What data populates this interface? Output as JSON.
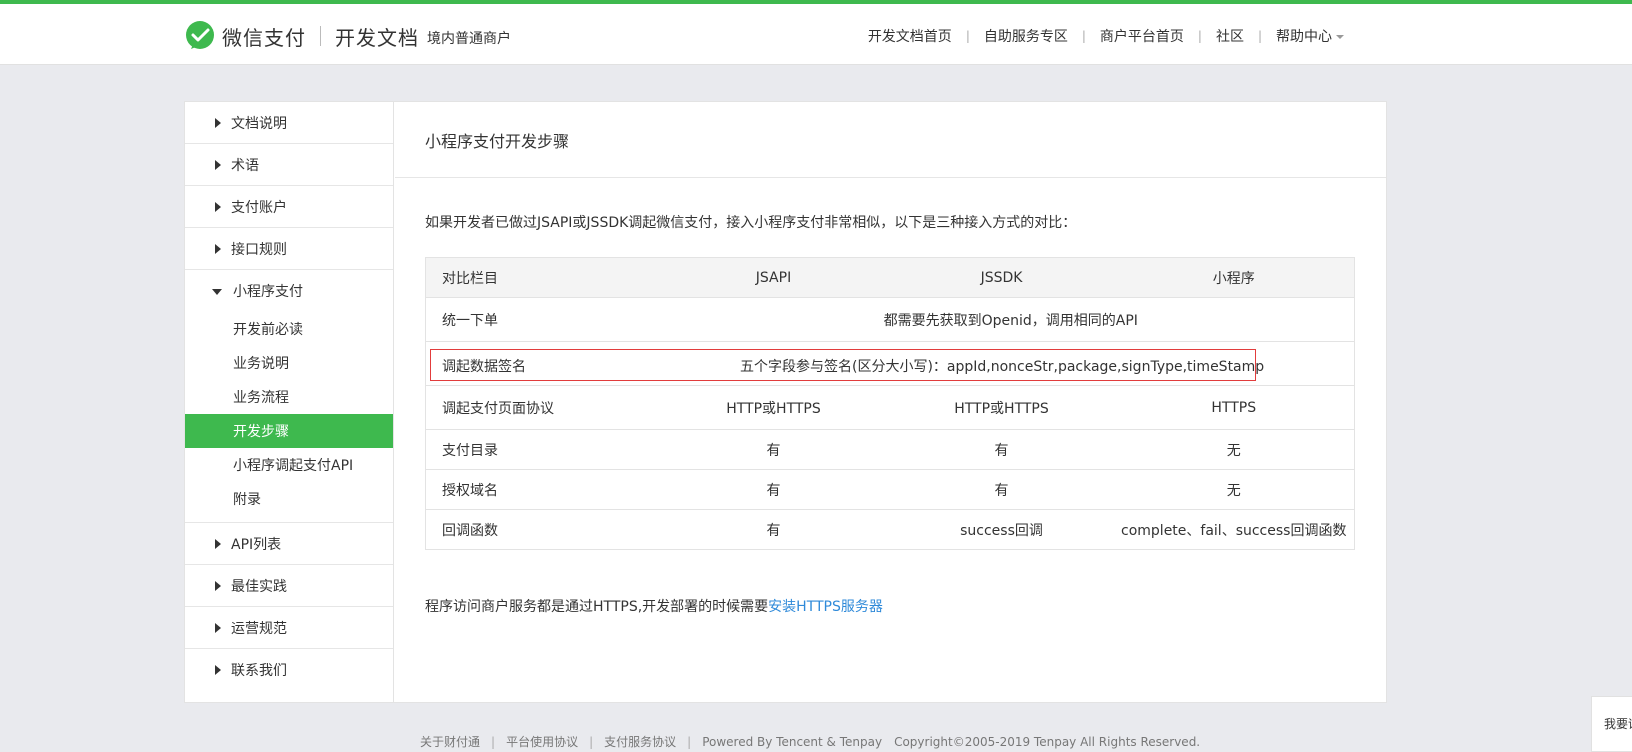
{
  "header": {
    "brand": "微信支付",
    "docs_title": "开发文档",
    "subtitle": "境内普通商户",
    "logo_icon": "wechat-pay-icon",
    "nav": [
      {
        "label": "开发文档首页"
      },
      {
        "label": "自助服务专区"
      },
      {
        "label": "商户平台首页"
      },
      {
        "label": "社区"
      },
      {
        "label": "帮助中心"
      }
    ]
  },
  "sidebar": {
    "items_top": [
      {
        "label": "文档说明"
      },
      {
        "label": "术语"
      },
      {
        "label": "支付账户"
      },
      {
        "label": "接口规则"
      }
    ],
    "expanded": {
      "label": "小程序支付",
      "children": [
        {
          "label": "开发前必读"
        },
        {
          "label": "业务说明"
        },
        {
          "label": "业务流程"
        },
        {
          "label": "开发步骤",
          "active": true
        },
        {
          "label": "小程序调起支付API"
        },
        {
          "label": "附录"
        }
      ]
    },
    "items_bottom": [
      {
        "label": "API列表"
      },
      {
        "label": "最佳实践"
      },
      {
        "label": "运营规范"
      },
      {
        "label": "联系我们"
      }
    ]
  },
  "content": {
    "title": "小程序支付开发步骤",
    "intro": "如果开发者已做过JSAPI或JSSDK调起微信支付，接入小程序支付非常相似，以下是三种接入方式的对比：",
    "table": {
      "headers": [
        "对比栏目",
        "JSAPI",
        "JSSDK",
        "小程序"
      ],
      "row_unified": {
        "label": "统一下单",
        "text": "都需要先获取到Openid，调用相同的API"
      },
      "row_sign": {
        "label": "调起数据签名",
        "text": "五个字段参与签名(区分大小写)：appId,nonceStr,package,signType,timeStamp"
      },
      "rows": [
        [
          "调起支付页面协议",
          "HTTP或HTTPS",
          "HTTP或HTTPS",
          "HTTPS"
        ],
        [
          "支付目录",
          "有",
          "有",
          "无"
        ],
        [
          "授权域名",
          "有",
          "有",
          "无"
        ],
        [
          "回调函数",
          "有",
          "success回调",
          "complete、fail、success回调函数"
        ]
      ]
    },
    "note_prefix": "程序访问商户服务都是通过HTTPS,开发部署的时候需要",
    "note_link": "安装HTTPS服务器"
  },
  "footer": {
    "links": [
      {
        "label": "关于财付通"
      },
      {
        "label": "平台使用协议"
      },
      {
        "label": "支付服务协议"
      }
    ],
    "powered": "Powered By Tencent & Tenpay",
    "copyright": "Copyright©2005-2019 Tenpay All Rights Reserved."
  },
  "float_help": "我要评价"
}
